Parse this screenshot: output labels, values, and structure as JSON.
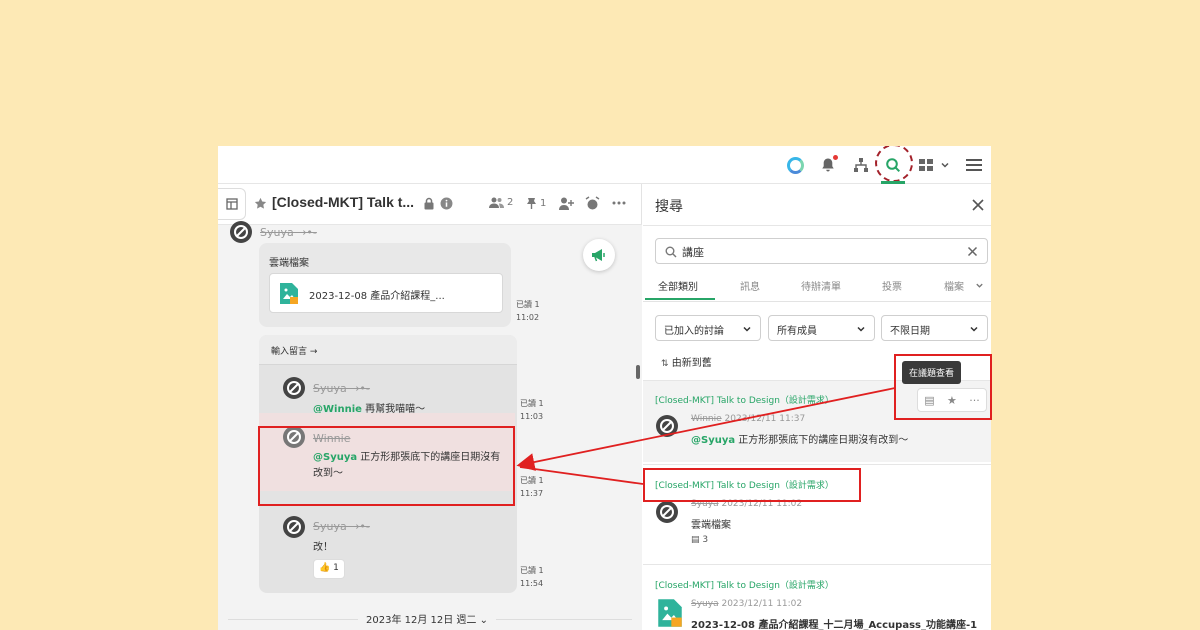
{
  "chat": {
    "title": "[Closed-MKT] Talk t...",
    "members_count": "2",
    "pins_count": "1"
  },
  "messages": {
    "top_sender": "Syuya →•-",
    "cloud_label": "雲端檔案",
    "file_name": "2023-12-08 產品介紹課程_...",
    "m1_read": "已讀 1",
    "m1_time": "11:02",
    "thread_header": "輸入留言 →",
    "r1_sender": "Syuya →•-",
    "r1_mention": "@Winnie",
    "r1_text": " 再幫我喵喵～",
    "r1_read": "已讀 1",
    "r1_time": "11:03",
    "r2_sender": "Winnie",
    "r2_mention": "@Syuya",
    "r2_text": " 正方形那張底下的講座日期沒有",
    "r2_text2": "改到～",
    "r2_read": "已讀 1",
    "r2_time": "11:37",
    "r3_sender": "Syuya →•-",
    "r3_text": "改！",
    "r3_reaction": "👍 1",
    "r3_read": "已讀 1",
    "r3_time": "11:54",
    "date_divider": "2023年 12月 12日 週二 ⌄"
  },
  "search": {
    "title": "搜尋",
    "query": "講座",
    "tabs": [
      "全部類別",
      "訊息",
      "待辦清單",
      "投票",
      "檔案"
    ],
    "filters": [
      "已加入的討論",
      "所有成員",
      "不限日期"
    ],
    "sort_label": "由新到舊",
    "tooltip": "在議題查看",
    "results": [
      {
        "channel": "[Closed-MKT] Talk to Design（設計需求）",
        "sender": "Winnie",
        "datetime": "2023/12/11 11:37",
        "mention": "@Syuya",
        "text": " 正方形那張底下的講座日期沒有改到～"
      },
      {
        "channel": "[Closed-MKT] Talk to Design（設計需求）",
        "sender": "Syuya",
        "datetime": "2023/12/11 11:02",
        "text": "雲端檔案",
        "replies": "3"
      },
      {
        "channel": "[Closed-MKT] Talk to Design（設計需求）",
        "sender": "Syuya",
        "datetime": "2023/12/11 11:02",
        "text": "2023-12-08 產品介紹課程_十二月場_Accupass_功能講座-1"
      }
    ]
  },
  "colors": {
    "brand_green": "#27a567",
    "annotation_red": "#e02020",
    "background": "#fde9b5"
  }
}
